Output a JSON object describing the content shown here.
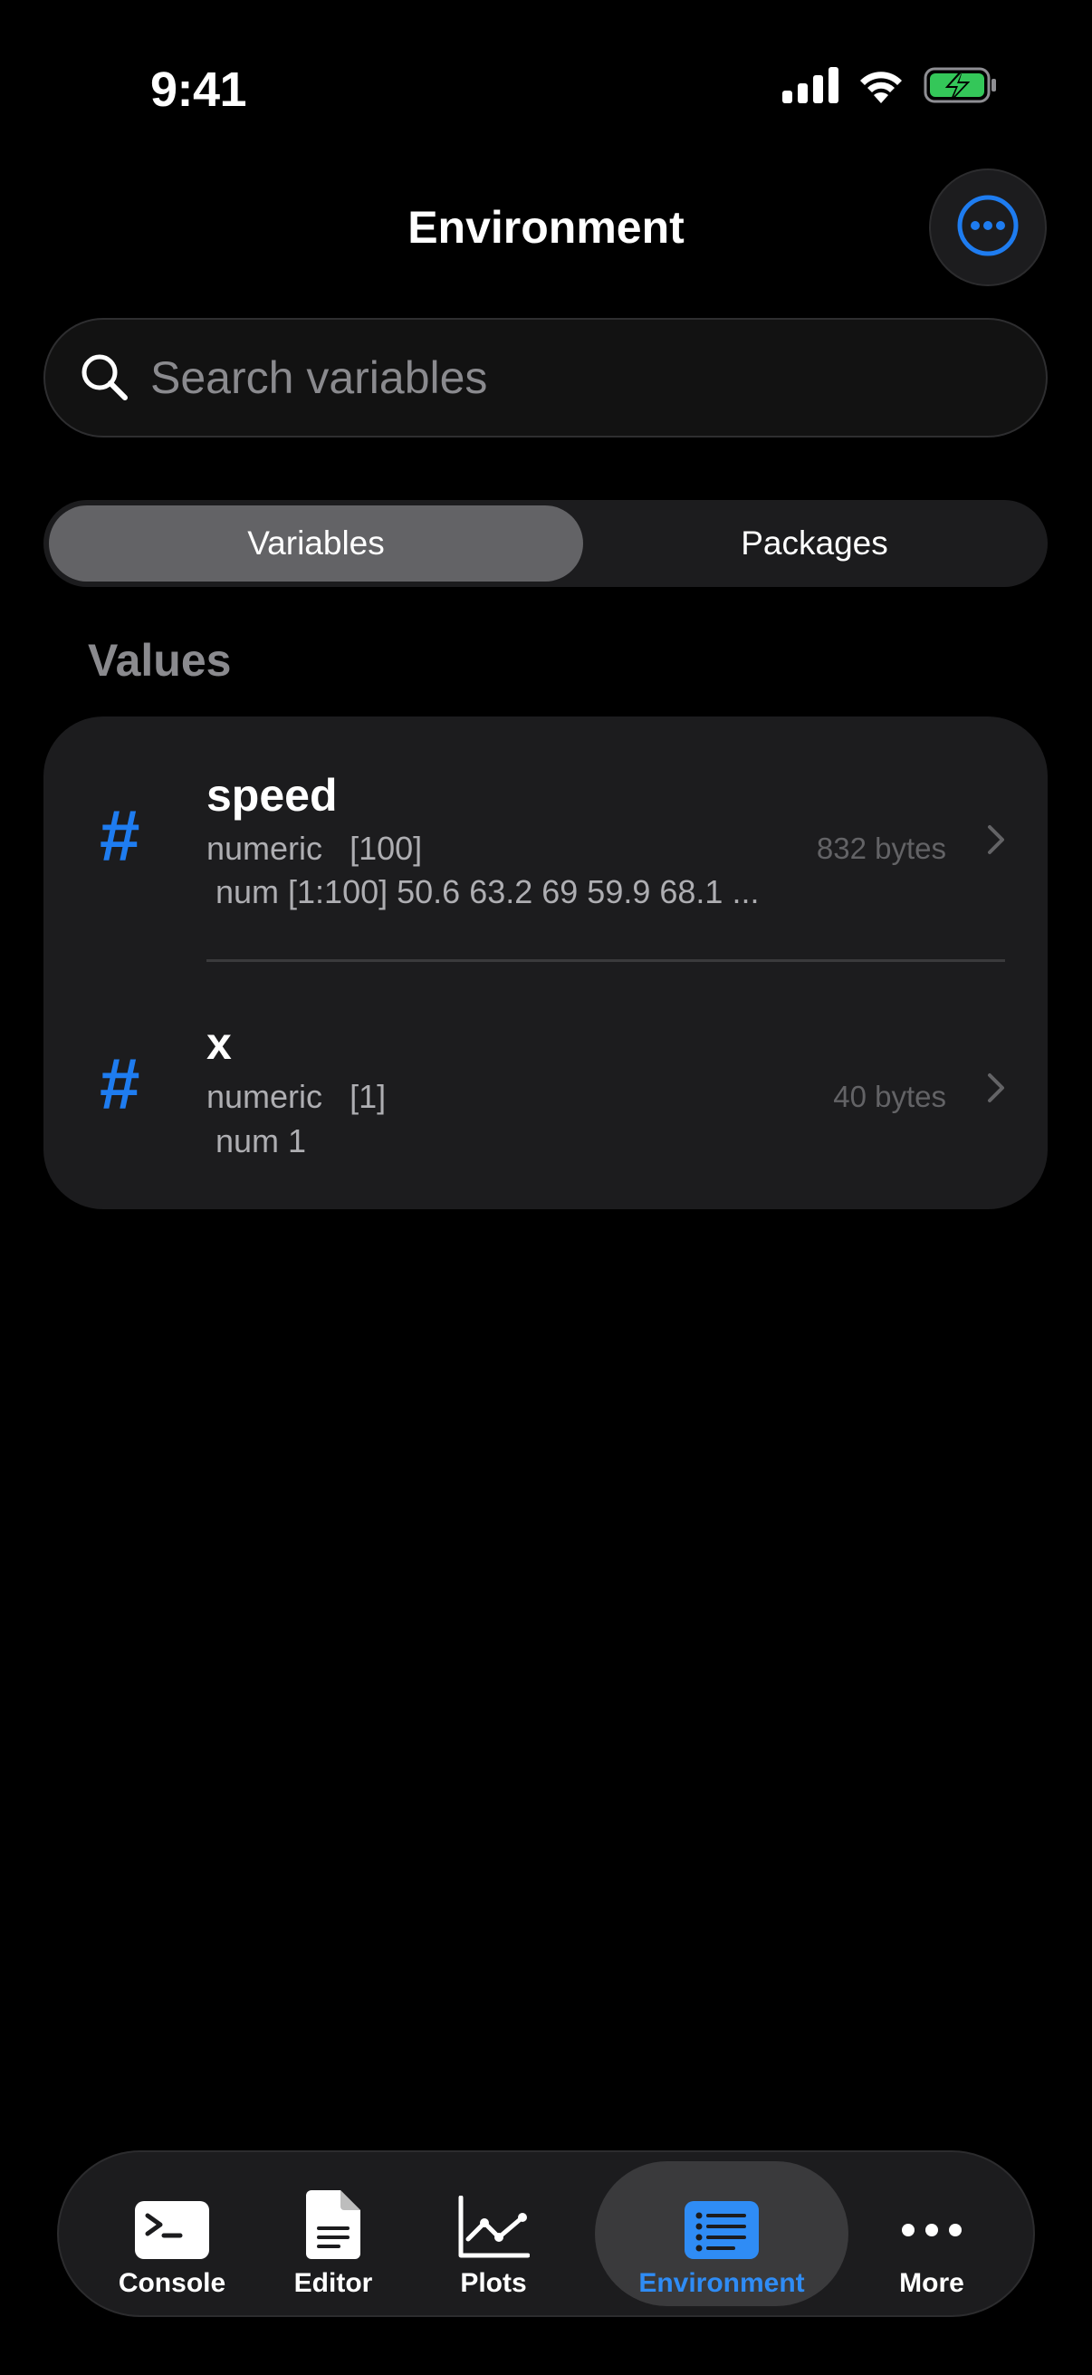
{
  "status_bar": {
    "time": "9:41",
    "icons": [
      "cellular-icon",
      "wifi-icon",
      "battery-charging-icon"
    ]
  },
  "header": {
    "title": "Environment",
    "more_icon": "ellipsis-circle-icon"
  },
  "search": {
    "placeholder": "Search variables",
    "value": "",
    "icon": "search-icon"
  },
  "segmented": {
    "tabs": [
      {
        "label": "Variables",
        "selected": true
      },
      {
        "label": "Packages",
        "selected": false
      }
    ]
  },
  "section": {
    "title": "Values"
  },
  "variables": [
    {
      "icon": "hash-icon",
      "name": "speed",
      "type": "numeric",
      "dims": "[100]",
      "preview": "num [1:100] 50.6 63.2 69 59.9 68.1 ...",
      "size": "832 bytes"
    },
    {
      "icon": "hash-icon",
      "name": "x",
      "type": "numeric",
      "dims": "[1]",
      "preview": "num 1",
      "size": "40 bytes"
    }
  ],
  "tabbar": {
    "items": [
      {
        "label": "Console",
        "icon": "terminal-icon",
        "active": false
      },
      {
        "label": "Editor",
        "icon": "document-icon",
        "active": false
      },
      {
        "label": "Plots",
        "icon": "line-chart-icon",
        "active": false
      },
      {
        "label": "Environment",
        "icon": "list-icon",
        "active": true
      },
      {
        "label": "More",
        "icon": "ellipsis-icon",
        "active": false
      }
    ]
  },
  "colors": {
    "accent": "#1e7cf0",
    "background": "#000000",
    "card": "#1c1c1e",
    "segment_active": "#636366",
    "secondary_text": "#aeaeb2"
  }
}
